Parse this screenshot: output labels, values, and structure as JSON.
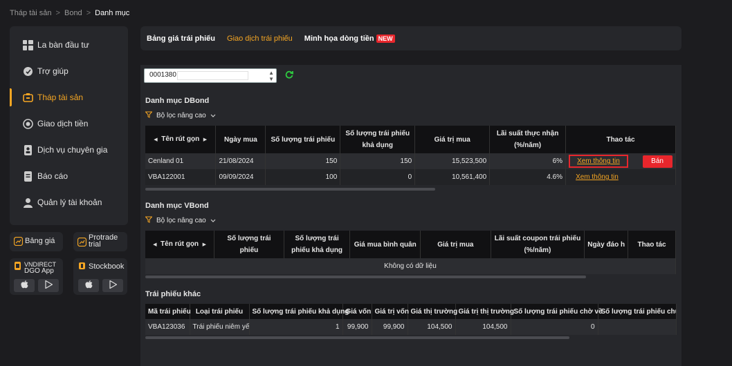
{
  "breadcrumb": {
    "items": [
      "Tháp tài sản",
      "Bond",
      "Danh mục"
    ],
    "sep": ">"
  },
  "sidebar": {
    "items": [
      {
        "label": "La bàn đầu tư",
        "icon": "grid-icon"
      },
      {
        "label": "Trợ giúp",
        "icon": "help-icon"
      },
      {
        "label": "Tháp tài sản",
        "icon": "wallet-icon",
        "active": true
      },
      {
        "label": "Giao dịch tiền",
        "icon": "money-icon"
      },
      {
        "label": "Dịch vụ chuyên gia",
        "icon": "expert-icon"
      },
      {
        "label": "Báo cáo",
        "icon": "report-icon"
      },
      {
        "label": "Quản lý tài khoản",
        "icon": "user-icon"
      }
    ]
  },
  "cards": {
    "bang_gia": "Bảng giá",
    "protrade_1": "Protrade",
    "protrade_2": "trial",
    "dgo_1": "VNDIRECT",
    "dgo_2": "DGO App",
    "stockbook": "Stockbook"
  },
  "tabs": {
    "t1": "Bảng giá trái phiếu",
    "t2": "Giao dịch trái phiếu",
    "t3": "Minh họa dòng tiền",
    "badge": "NEW"
  },
  "account": {
    "value": "0001380"
  },
  "dbond": {
    "title": "Danh mục DBond",
    "filter": "Bộ lọc nâng cao",
    "headers": [
      "Tên rút gọn",
      "Ngày mua",
      "Số lượng trái phiếu",
      "Số lượng trái phiếu khả dụng",
      "Giá trị mua",
      "Lãi suất thực nhận (%/năm)",
      "Thao tác"
    ],
    "rows": [
      {
        "name": "Cenland 01",
        "date": "21/08/2024",
        "qty": "150",
        "avail": "150",
        "value": "15,523,500",
        "rate": "6%",
        "view": "Xem thông tin",
        "sell": "Bán"
      },
      {
        "name": "VBA122001",
        "date": "09/09/2024",
        "qty": "100",
        "avail": "0",
        "value": "10,561,400",
        "rate": "4.6%",
        "view": "Xem thông tin"
      }
    ]
  },
  "vbond": {
    "title": "Danh mục VBond",
    "filter": "Bộ lọc nâng cao",
    "headers": [
      "Tên rút gọn",
      "Số lượng trái phiếu",
      "Số lượng trái phiếu khả dụng",
      "Giá mua bình quân",
      "Giá trị mua",
      "Lãi suất coupon trái phiếu (%/năm)",
      "Ngày đáo h",
      "Thao tác"
    ],
    "empty": "Không có dữ liệu"
  },
  "other": {
    "title": "Trái phiếu khác",
    "headers": [
      "Mã trái phiếu",
      "Loại trái phiếu",
      "Số lượng trái phiếu khả dụng",
      "Giá vốn",
      "Giá trị vốn",
      "Giá thị trường",
      "Giá trị thị trường",
      "Số lượng trái phiếu chờ về",
      "Số lượng trái phiếu chưa"
    ],
    "rows": [
      {
        "code": "VBA123036",
        "type": "Trái phiếu niêm yết",
        "avail": "1",
        "cost": "99,900",
        "cost_value": "99,900",
        "market": "104,500",
        "market_value": "104,500",
        "pending": "0"
      }
    ]
  }
}
